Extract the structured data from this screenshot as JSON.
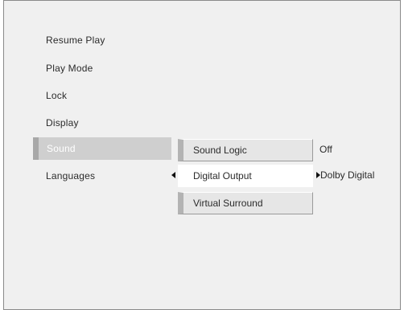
{
  "menu": {
    "items": [
      {
        "label": "Resume Play"
      },
      {
        "label": "Play Mode"
      },
      {
        "label": "Lock"
      },
      {
        "label": "Display"
      },
      {
        "label": "Sound"
      },
      {
        "label": "Languages"
      }
    ],
    "selected_index": 4
  },
  "submenu": {
    "items": [
      {
        "label": "Sound Logic",
        "value": "Off"
      },
      {
        "label": "Digital Output",
        "value": "Dolby Digital"
      },
      {
        "label": "Virtual Surround",
        "value": ""
      }
    ],
    "active_index": 1
  },
  "colors": {
    "background": "#f0f0f0",
    "selected_bg": "#cfcfcf",
    "submenu_bg": "#e6e6e6",
    "active_bg": "#ffffff"
  },
  "icons": {
    "prev": "caret-left-icon",
    "next": "caret-right-icon"
  }
}
